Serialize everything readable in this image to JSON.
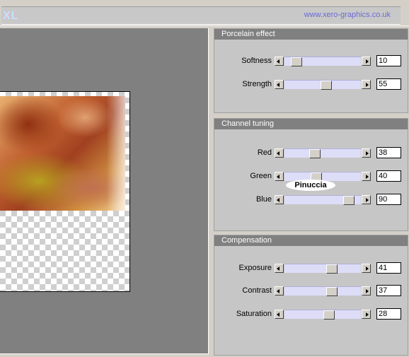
{
  "header": {
    "logo": "XL",
    "url": "www.xero-graphics.co.uk"
  },
  "panels": [
    {
      "title": "Porcelain effect",
      "sliders": [
        {
          "label": "Softness",
          "value": "10",
          "level": 0.1
        },
        {
          "label": "Strength",
          "value": "55",
          "level": 0.55
        }
      ]
    },
    {
      "title": "Channel tuning",
      "sliders": [
        {
          "label": "Red",
          "value": "38",
          "level": 0.38
        },
        {
          "label": "Green",
          "value": "40",
          "level": 0.4
        },
        {
          "label": "Blue",
          "value": "90",
          "level": 0.9
        }
      ]
    },
    {
      "title": "Compensation",
      "sliders": [
        {
          "label": "Exposure",
          "value": "41",
          "level": 0.64
        },
        {
          "label": "Contrast",
          "value": "37",
          "level": 0.64
        },
        {
          "label": "Saturation",
          "value": "28",
          "level": 0.6
        }
      ]
    }
  ],
  "watermark": "Pinuccia",
  "colors": {
    "background": "#d4d0c8",
    "panel": "#c6c6c6",
    "panel_title": "#808080",
    "track": "#ddddf8",
    "url": "#6a6ad8"
  }
}
